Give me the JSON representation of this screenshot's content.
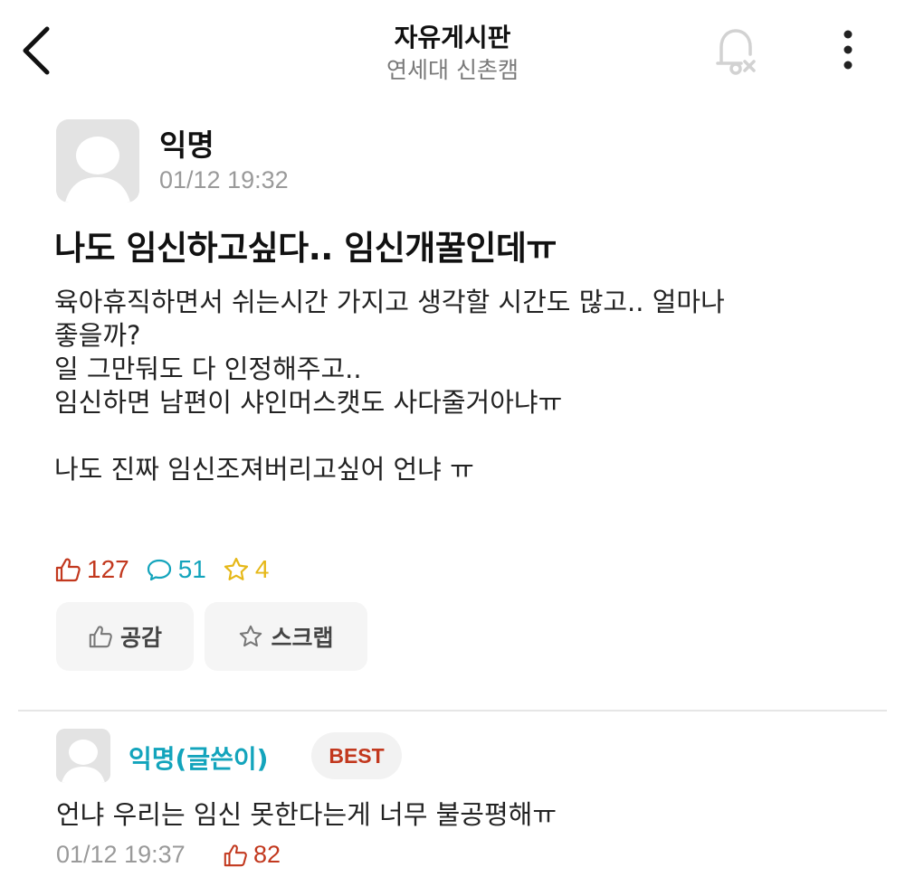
{
  "header": {
    "title": "자유게시판",
    "subtitle": "연세대 신촌캠"
  },
  "post": {
    "author": "익명",
    "time": "01/12 19:32",
    "title": "나도 임신하고싶다.. 임신개꿀인데ㅠ",
    "body_lines": [
      "육아휴직하면서 쉬는시간 가지고 생각할 시간도 많고.. 얼마나",
      "좋을까?",
      "일 그만둬도 다 인정해주고..",
      "임신하면 남편이 샤인머스캣도 사다줄거아냐ㅠ",
      "",
      "나도 진짜 임신조져버리고싶어 언냐 ㅠ"
    ],
    "stats": {
      "likes": "127",
      "comments": "51",
      "scraps": "4"
    },
    "actions": {
      "like_label": "공감",
      "scrap_label": "스크랩"
    }
  },
  "comment": {
    "author": "익명(글쓴이)",
    "badge": "BEST",
    "text": "언냐 우리는 임신 못한다는게 너무 불공평해ㅠ",
    "time": "01/12 19:37",
    "likes": "82"
  },
  "icons": {
    "back": "chevron-left-icon",
    "notification": "bell-off-icon",
    "more": "more-vertical-icon",
    "like": "thumbs-up-icon",
    "comment": "speech-bubble-icon",
    "scrap": "star-icon"
  },
  "colors": {
    "like": "#c2381e",
    "comment": "#13a4bc",
    "scrap": "#e6b818",
    "muted": "#9a9a9a"
  }
}
